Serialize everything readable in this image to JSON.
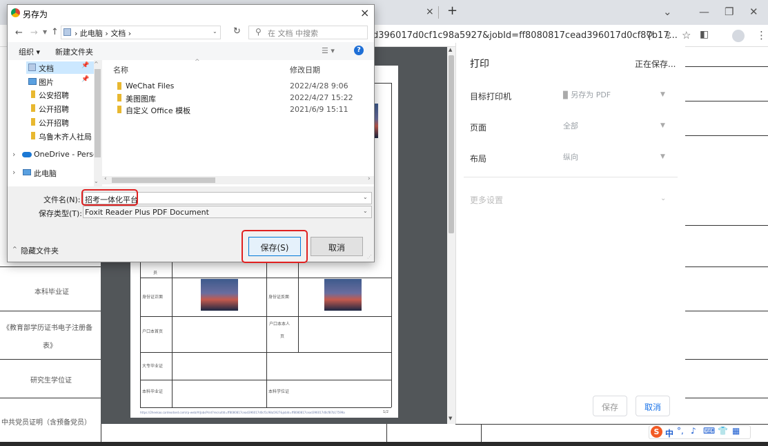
{
  "browser": {
    "url": "d396017d0cf1c98a5927&jobId=ff8080817cead396017d0cf87b17...",
    "icons": [
      "zoom-icon",
      "share-icon",
      "star-icon",
      "side-panel-icon",
      "profile-icon",
      "menu-icon"
    ]
  },
  "background_doc": {
    "rows": [
      "本科毕业证",
      "《教育部学历证书电子注册备",
      "表》",
      "研究生学位证",
      "中共党员证明（含预备党员）"
    ]
  },
  "preview": {
    "labels": {
      "r1": "员",
      "id_front": "身份证正面",
      "id_back": "身份证反面",
      "hukou_home": "户口本首页",
      "hukou_self_1": "户口本本人",
      "hukou_self_2": "页",
      "college_cert": "大专毕业证",
      "bachelor_cert": "本科毕业证",
      "bachelor_degree": "本科学位证"
    },
    "footer_url": "https://2heekao.cardeodsed.com/rp-web/#/JobsPrint?recruitId=ff8080817cead396017d0cf1c98a5927&jobId=ff8080817cead396017d0cf87b17599a",
    "footer_page": "1/2"
  },
  "print_panel": {
    "title": "打印",
    "status": "正在保存...",
    "destination_label": "目标打印机",
    "destination_value": "另存为 PDF",
    "pages_label": "页面",
    "pages_value": "全部",
    "layout_label": "布局",
    "layout_value": "纵向",
    "more_settings": "更多设置",
    "save_btn": "保存",
    "cancel_btn": "取消"
  },
  "dialog": {
    "title": "另存为",
    "close": "×",
    "breadcrumb": [
      "此电脑",
      "文档"
    ],
    "search_placeholder": "在 文档 中搜索",
    "toolbar": {
      "organize": "组织 ▾",
      "new_folder": "新建文件夹"
    },
    "nav": [
      {
        "label": "文档",
        "pin": "📌"
      },
      {
        "label": "图片",
        "pin": "📌"
      },
      {
        "label": "公安招聘"
      },
      {
        "label": "公开招聘"
      },
      {
        "label": "公开招聘"
      },
      {
        "label": "乌鲁木齐人社局"
      },
      {
        "label": "OneDrive - Persc"
      },
      {
        "label": "此电脑"
      }
    ],
    "columns": {
      "name": "名称",
      "date": "修改日期"
    },
    "files": [
      {
        "name": "WeChat Files",
        "date": "2022/4/28 9:06"
      },
      {
        "name": "美图图库",
        "date": "2022/4/27 15:22"
      },
      {
        "name": "自定义 Office 模板",
        "date": "2021/6/9 15:11"
      }
    ],
    "filename_label": "文件名(N):",
    "filename_value": "招考一体化平台",
    "filetype_label": "保存类型(T):",
    "filetype_value": "Foxit Reader Plus PDF Document",
    "hide_folders": "隐藏文件夹",
    "save_btn": "保存(S)",
    "cancel_btn": "取消"
  },
  "ime": {
    "label": "中"
  }
}
